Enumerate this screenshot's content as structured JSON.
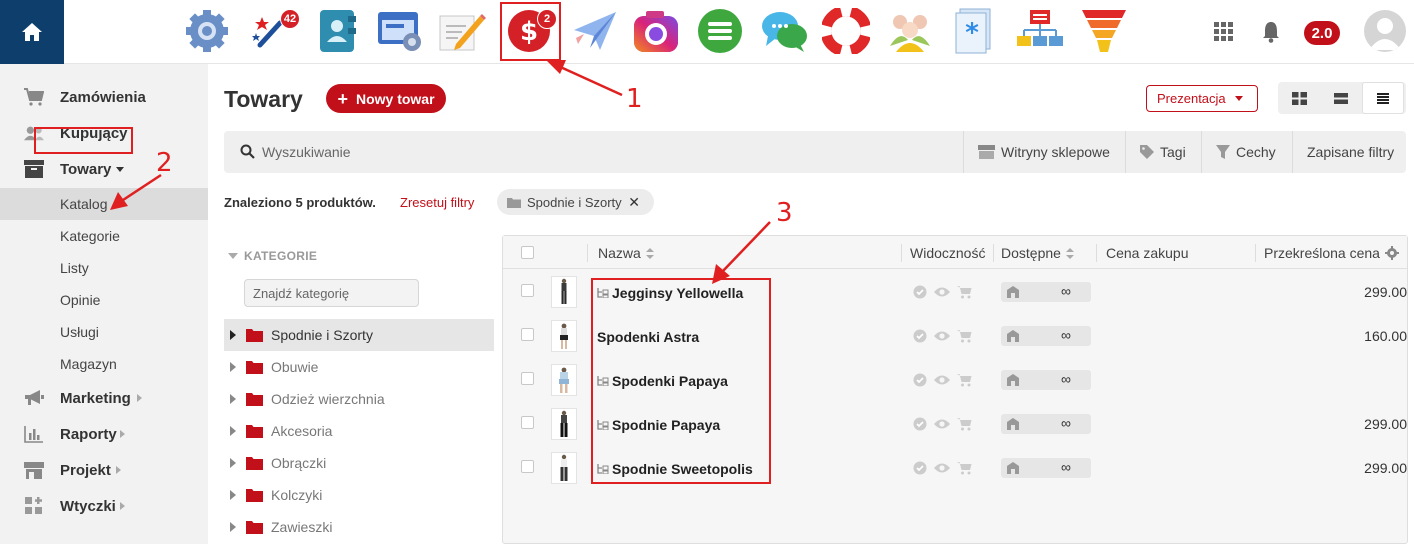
{
  "topbar": {
    "home_icon": "home-icon",
    "apps": [
      {
        "name": "settings-gear-icon",
        "badge": ""
      },
      {
        "name": "magic-wand-icon",
        "badge": "42"
      },
      {
        "name": "contacts-book-icon",
        "badge": ""
      },
      {
        "name": "browser-settings-icon",
        "badge": ""
      },
      {
        "name": "edit-pencil-icon",
        "badge": ""
      },
      {
        "name": "dollar-sales-icon",
        "badge": "2"
      },
      {
        "name": "paper-plane-icon",
        "badge": ""
      },
      {
        "name": "camera-icon",
        "badge": ""
      },
      {
        "name": "menu-list-icon",
        "badge": ""
      },
      {
        "name": "chat-bubbles-icon",
        "badge": ""
      },
      {
        "name": "lifebuoy-icon",
        "badge": ""
      },
      {
        "name": "users-group-icon",
        "badge": ""
      },
      {
        "name": "document-asterisk-icon",
        "badge": ""
      },
      {
        "name": "sitemap-icon",
        "badge": ""
      },
      {
        "name": "funnel-icon",
        "badge": ""
      }
    ],
    "version": "2.0"
  },
  "sidebar": {
    "main": [
      {
        "label": "Zamówienia",
        "icon": "cart-icon"
      },
      {
        "label": "Kupujący",
        "icon": "users-icon"
      },
      {
        "label": "Towary",
        "icon": "archive-box-icon"
      }
    ],
    "sub": [
      "Katalog",
      "Kategorie",
      "Listy",
      "Opinie",
      "Usługi",
      "Magazyn"
    ],
    "more": [
      {
        "label": "Marketing",
        "icon": "megaphone-icon"
      },
      {
        "label": "Raporty",
        "icon": "bar-chart-icon"
      },
      {
        "label": "Projekt",
        "icon": "storefront-icon"
      },
      {
        "label": "Wtyczki",
        "icon": "puzzle-grid-icon"
      }
    ]
  },
  "main": {
    "title": "Towary",
    "new_button": "Nowy towar",
    "presentation": "Prezentacja",
    "search_placeholder": "Wyszukiwanie",
    "filters": [
      "Witryny sklepowe",
      "Tagi",
      "Cechy",
      "Zapisane filtry"
    ],
    "found": "Znaleziono 5 produktów.",
    "reset": "Zresetuj filtry",
    "chip": "Spodnie i Szorty"
  },
  "categories": {
    "heading": "KATEGORIE",
    "search_placeholder": "Znajdź kategorię",
    "items": [
      "Spodnie i Szorty",
      "Obuwie",
      "Odzież wierzchnia",
      "Akcesoria",
      "Obrączki",
      "Kolczyki",
      "Zawieszki"
    ]
  },
  "table": {
    "columns": [
      "Nazwa",
      "Widoczność",
      "Dostępne",
      "Cena zakupu",
      "Przekreślona cena"
    ],
    "rows": [
      {
        "name": "Jegginsy Yellowella",
        "variants": true,
        "available": "∞",
        "price": "299.00"
      },
      {
        "name": "Spodenki Astra",
        "variants": false,
        "available": "∞",
        "price": "160.00"
      },
      {
        "name": "Spodenki Papaya",
        "variants": true,
        "available": "∞",
        "price": ""
      },
      {
        "name": "Spodnie Papaya",
        "variants": true,
        "available": "∞",
        "price": "299.00"
      },
      {
        "name": "Spodnie Sweetopolis",
        "variants": true,
        "available": "∞",
        "price": "299.00"
      }
    ]
  },
  "annotations": [
    "1",
    "2",
    "3"
  ],
  "colors": {
    "accent": "#c2101a",
    "home": "#0e3e6b",
    "annotation": "#e02020"
  }
}
